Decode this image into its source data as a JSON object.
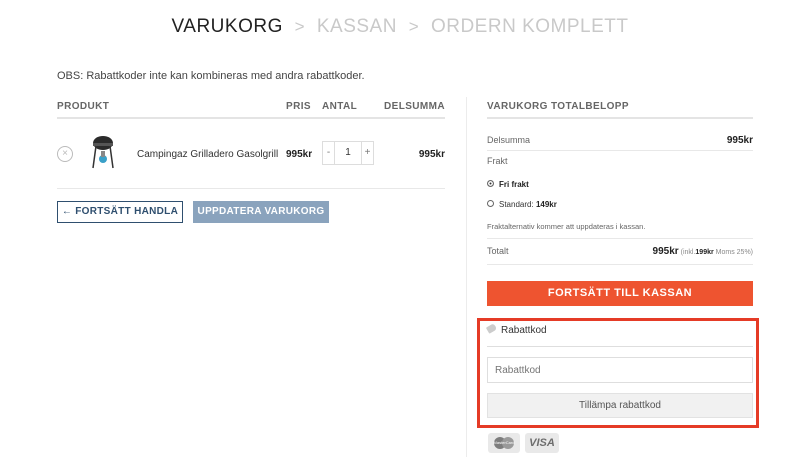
{
  "breadcrumb": {
    "step1": "VARUKORG",
    "sep": ">",
    "step2": "KASSAN",
    "step3": "ORDERN KOMPLETT"
  },
  "notice": "OBS: Rabattkoder inte kan kombineras med andra rabattkoder.",
  "cart": {
    "headers": {
      "product": "PRODUKT",
      "price": "PRIS",
      "qty": "ANTAL",
      "subtotal": "DELSUMMA"
    },
    "items": [
      {
        "remove": "×",
        "name": "Campingaz Grilladero Gasolgrill",
        "price": "995kr",
        "qty_minus": "-",
        "qty": "1",
        "qty_plus": "+",
        "subtotal": "995kr"
      }
    ],
    "continue_label": "← FORTSÄTT HANDLA",
    "update_label": "UPPDATERA VARUKORG"
  },
  "totals": {
    "title": "VARUKORG TOTALBELOPP",
    "subtotal_label": "Delsumma",
    "subtotal_value": "995kr",
    "shipping_label": "Frakt",
    "shipping_options": [
      {
        "label": "Fri frakt",
        "selected": true
      },
      {
        "label": "Standard:",
        "price": "149kr",
        "selected": false
      }
    ],
    "shipping_note": "Fraktalternativ kommer att uppdateras i kassan.",
    "total_label": "Totalt",
    "total_value": "995kr",
    "total_incl_prefix": "(inkl.",
    "total_incl_value": "199kr",
    "total_incl_suffix": "Moms 25%)",
    "checkout_label": "FORTSÄTT TILL KASSAN"
  },
  "coupon": {
    "title": "Rabattkod",
    "placeholder": "Rabattkod",
    "apply_label": "Tillämpa rabattkod"
  },
  "payment": {
    "mastercard": "MasterCard",
    "visa": "VISA"
  },
  "colors": {
    "accent": "#ee5430",
    "highlight_border": "#e53b26",
    "update_button": "#8aa3bd",
    "continue_border": "#2f4f6f"
  }
}
